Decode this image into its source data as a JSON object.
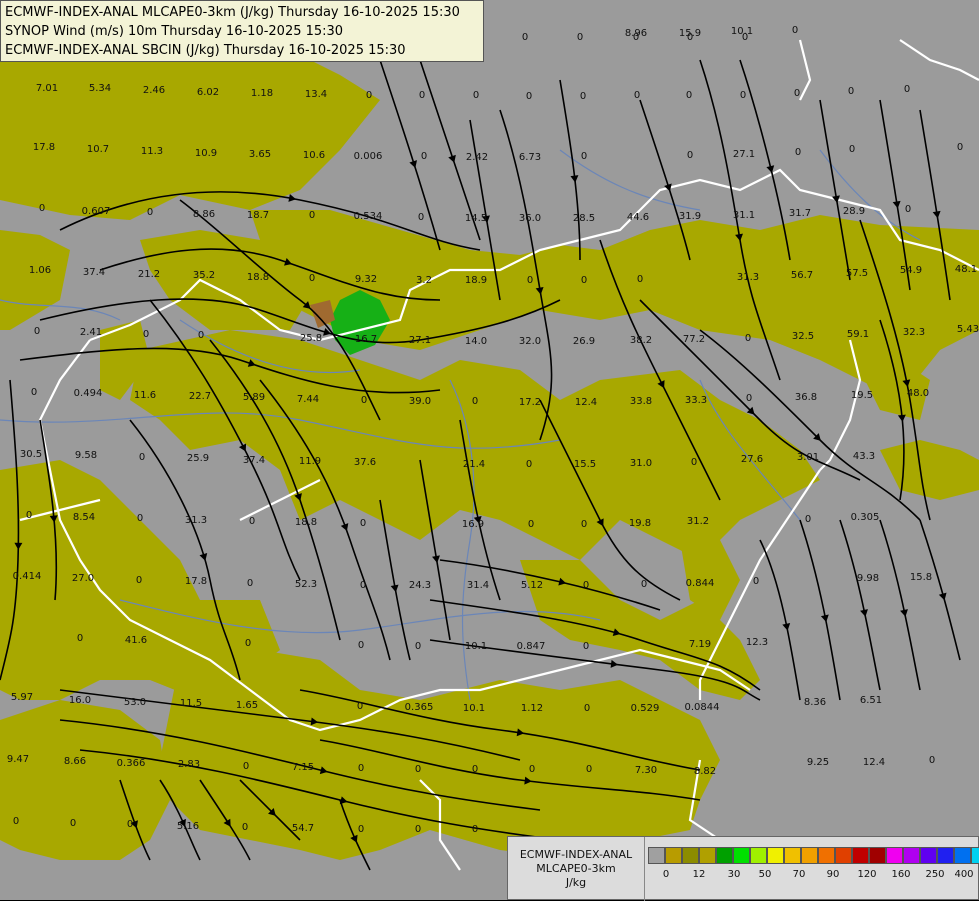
{
  "title_lines": [
    "ECMWF-INDEX-ANAL MLCAPE0-3km (J/kg) Thursday 16-10-2025 15:30",
    "SYNOP Wind (m/s) 10m Thursday 16-10-2025 15:30",
    "ECMWF-INDEX-ANAL SBCIN (J/kg) Thursday 16-10-2025 15:30"
  ],
  "colors": {
    "background": "#9b9b9b",
    "low_cape": "#a8a800",
    "mid_cape": "#16b016",
    "border": "#ffffff",
    "rivers": "#6b86b8",
    "streamlines": "#000000"
  },
  "values": [
    "0",
    "0",
    "0",
    "0",
    "0",
    "8.96",
    "15.9",
    "10.1",
    "0",
    "7.01",
    "5.34",
    "2.46",
    "6.02",
    "1.18",
    "13.4",
    "0",
    "0",
    "0",
    "0",
    "0",
    "0",
    "0",
    "0",
    "0",
    "0",
    "0",
    "17.8",
    "10.7",
    "11.3",
    "10.9",
    "3.65",
    "10.6",
    "0.006",
    "0",
    "2.42",
    "6.73",
    "0",
    "0",
    "27.1",
    "0",
    "0",
    "0",
    "0",
    "0.607",
    "0",
    "8.86",
    "18.7",
    "0",
    "0.534",
    "0",
    "14.5",
    "36.0",
    "28.5",
    "44.6",
    "31.9",
    "31.1",
    "31.7",
    "28.9",
    "0",
    "1.06",
    "37.4",
    "21.2",
    "35.2",
    "18.8",
    "0",
    "9.32",
    "3.2",
    "18.9",
    "0",
    "0",
    "0",
    "31.3",
    "56.7",
    "57.5",
    "54.9",
    "48.1",
    "0",
    "2.41",
    "0",
    "0",
    "25.8",
    "16.7",
    "27.1",
    "14.0",
    "32.0",
    "26.9",
    "38.2",
    "77.2",
    "0",
    "32.5",
    "59.1",
    "32.3",
    "5.43",
    "0",
    "0.494",
    "11.6",
    "22.7",
    "5.89",
    "7.44",
    "0",
    "39.0",
    "0",
    "17.2",
    "12.4",
    "33.8",
    "33.3",
    "0",
    "36.8",
    "19.5",
    "48.0",
    "30.5",
    "9.58",
    "0",
    "25.9",
    "37.4",
    "11.9",
    "37.6",
    "21.4",
    "0",
    "15.5",
    "31.0",
    "0",
    "27.6",
    "3.01",
    "43.3",
    "0",
    "8.54",
    "0",
    "31.3",
    "0",
    "18.8",
    "0",
    "16.9",
    "0",
    "0",
    "19.8",
    "31.2",
    "0",
    "0.305",
    "0.414",
    "27.0",
    "0",
    "17.8",
    "0",
    "52.3",
    "0",
    "24.3",
    "31.4",
    "5.12",
    "0",
    "0",
    "0.844",
    "0",
    "9.98",
    "15.8",
    "0",
    "41.6",
    "0",
    "0",
    "0",
    "10.1",
    "0.847",
    "0",
    "7.19",
    "12.3",
    "5.97",
    "16.0",
    "53.0",
    "11.5",
    "1.65",
    "0",
    "0.365",
    "10.1",
    "1.12",
    "0",
    "0.529",
    "0.0844",
    "8.36",
    "6.51",
    "9.47",
    "8.66",
    "0.366",
    "2.83",
    "0",
    "7.15",
    "0",
    "0",
    "0",
    "0",
    "0",
    "7.30",
    "8.82",
    "9.25",
    "12.4",
    "0",
    "0",
    "0",
    "0",
    "5.16",
    "0",
    "54.7",
    "0",
    "0",
    "0"
  ],
  "legend": {
    "line1": "ECMWF-INDEX-ANAL",
    "line2": "MLCAPE0-3km",
    "line3": "J/kg",
    "swatch_colors": [
      "#a0a0a0",
      "#b89c00",
      "#8c8c00",
      "#b0a000",
      "#00a000",
      "#00e000",
      "#a0f000",
      "#f0f000",
      "#f0c000",
      "#f0a000",
      "#f07000",
      "#e04000",
      "#c00000",
      "#a00000",
      "#f000f0",
      "#b000f0",
      "#6000f0",
      "#2020f0",
      "#0070f0",
      "#00d0f0",
      "#80ffff",
      "#ffffff"
    ],
    "ticks": [
      "0",
      "12",
      "30",
      "50",
      "70",
      "90",
      "120",
      "160",
      "250",
      "400"
    ]
  }
}
